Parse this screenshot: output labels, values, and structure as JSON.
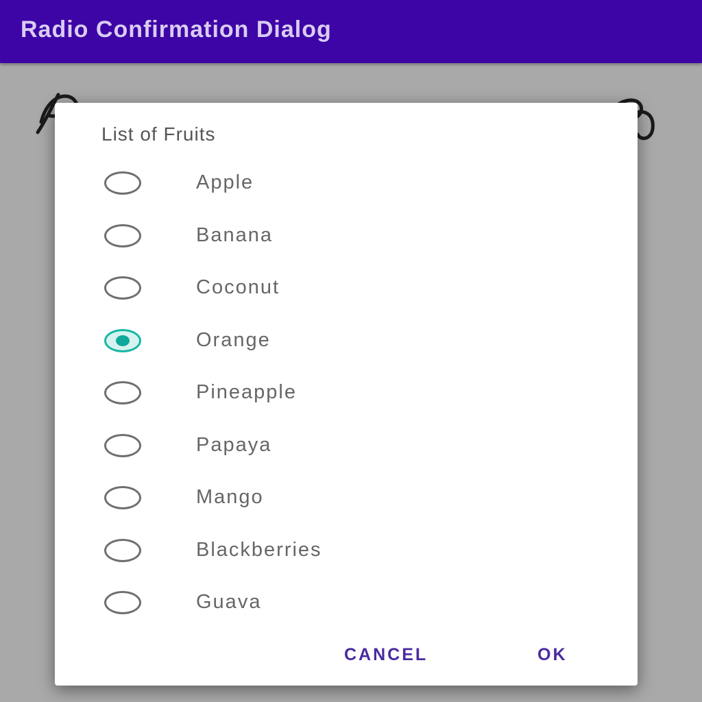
{
  "app_bar": {
    "title": "Radio Confirmation Dialog",
    "color": "#3d04a6"
  },
  "dialog": {
    "title": "List of Fruits",
    "options": [
      {
        "label": "Apple",
        "selected": false
      },
      {
        "label": "Banana",
        "selected": false
      },
      {
        "label": "Coconut",
        "selected": false
      },
      {
        "label": "Orange",
        "selected": true
      },
      {
        "label": "Pineapple",
        "selected": false
      },
      {
        "label": "Papaya",
        "selected": false
      },
      {
        "label": "Mango",
        "selected": false
      },
      {
        "label": "Blackberries",
        "selected": false
      },
      {
        "label": "Guava",
        "selected": false
      }
    ],
    "cancel_label": "CANCEL",
    "ok_label": "OK",
    "accent_color": "#17b6a6"
  }
}
